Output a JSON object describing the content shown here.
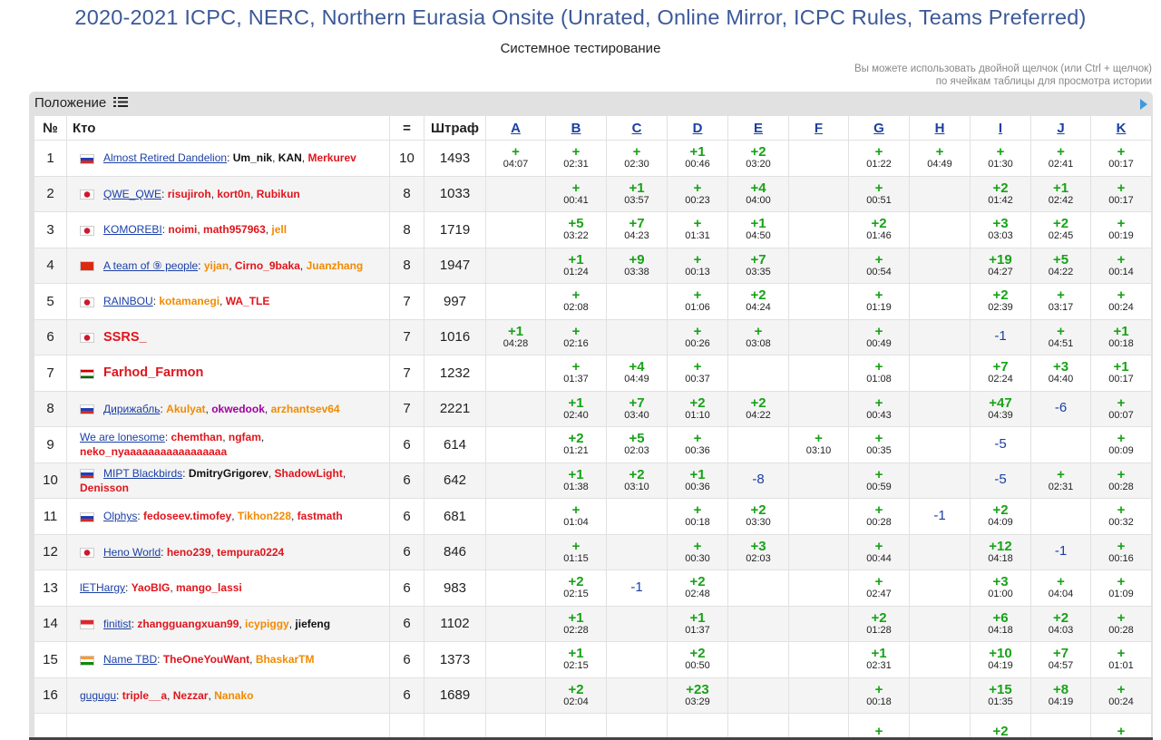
{
  "header": {
    "title": "2020-2021 ICPC, NERC, Northern Eurasia Onsite (Unrated, Online Mirror, ICPC Rules, Teams Preferred)",
    "subtitle": "Системное тестирование",
    "hint_line1": "Вы можете использовать двойной щелчок (или Ctrl + щелчок)",
    "hint_line2": "по ячейкам таблицы для просмотра истории"
  },
  "standings": {
    "panel_label": "Положение",
    "columns": {
      "rank": "№",
      "who": "Кто",
      "solved": "=",
      "penalty": "Штраф"
    },
    "problems": [
      "A",
      "B",
      "C",
      "D",
      "E",
      "F",
      "G",
      "H",
      "I",
      "J",
      "K"
    ],
    "rows": [
      {
        "rank": "1",
        "flag": "ru",
        "team": "Almost Retired Dandelion",
        "members": [
          {
            "n": "Um_nik",
            "c": "black"
          },
          {
            "n": "KAN",
            "c": "black"
          },
          {
            "n": "Merkurev",
            "c": "red"
          }
        ],
        "solved": "10",
        "penalty": "1493",
        "cells": [
          {
            "r": "+",
            "t": "04:07"
          },
          {
            "r": "+",
            "t": "02:31"
          },
          {
            "r": "+",
            "t": "02:30"
          },
          {
            "r": "+1",
            "t": "00:46"
          },
          {
            "r": "+2",
            "t": "03:20"
          },
          {},
          {
            "r": "+",
            "t": "01:22"
          },
          {
            "r": "+",
            "t": "04:49"
          },
          {
            "r": "+",
            "t": "01:30"
          },
          {
            "r": "+",
            "t": "02:41"
          },
          {
            "r": "+",
            "t": "00:17"
          }
        ]
      },
      {
        "rank": "2",
        "flag": "jp",
        "team": "QWE_QWE",
        "members": [
          {
            "n": "risujiroh",
            "c": "red"
          },
          {
            "n": "kort0n",
            "c": "red"
          },
          {
            "n": "Rubikun",
            "c": "red"
          }
        ],
        "solved": "8",
        "penalty": "1033",
        "cells": [
          {},
          {
            "r": "+",
            "t": "00:41"
          },
          {
            "r": "+1",
            "t": "03:57"
          },
          {
            "r": "+",
            "t": "00:23"
          },
          {
            "r": "+4",
            "t": "04:00"
          },
          {},
          {
            "r": "+",
            "t": "00:51"
          },
          {},
          {
            "r": "+2",
            "t": "01:42"
          },
          {
            "r": "+1",
            "t": "02:42"
          },
          {
            "r": "+",
            "t": "00:17"
          }
        ]
      },
      {
        "rank": "3",
        "flag": "jp",
        "team": "KOMOREBI",
        "members": [
          {
            "n": "noimi",
            "c": "red"
          },
          {
            "n": "math957963",
            "c": "red"
          },
          {
            "n": "jell",
            "c": "orange"
          }
        ],
        "solved": "8",
        "penalty": "1719",
        "cells": [
          {},
          {
            "r": "+5",
            "t": "03:22"
          },
          {
            "r": "+7",
            "t": "04:23"
          },
          {
            "r": "+",
            "t": "01:31"
          },
          {
            "r": "+1",
            "t": "04:50"
          },
          {},
          {
            "r": "+2",
            "t": "01:46"
          },
          {},
          {
            "r": "+3",
            "t": "03:03"
          },
          {
            "r": "+2",
            "t": "02:45"
          },
          {
            "r": "+",
            "t": "00:19"
          }
        ]
      },
      {
        "rank": "4",
        "flag": "cn",
        "team": "A team of ⑨ people",
        "members": [
          {
            "n": "yijan",
            "c": "orange"
          },
          {
            "n": "Cirno_9baka",
            "c": "red"
          },
          {
            "n": "Juanzhang",
            "c": "orange"
          }
        ],
        "solved": "8",
        "penalty": "1947",
        "cells": [
          {},
          {
            "r": "+1",
            "t": "01:24"
          },
          {
            "r": "+9",
            "t": "03:38"
          },
          {
            "r": "+",
            "t": "00:13"
          },
          {
            "r": "+7",
            "t": "03:35"
          },
          {},
          {
            "r": "+",
            "t": "00:54"
          },
          {},
          {
            "r": "+19",
            "t": "04:27"
          },
          {
            "r": "+5",
            "t": "04:22"
          },
          {
            "r": "+",
            "t": "00:14"
          }
        ]
      },
      {
        "rank": "5",
        "flag": "jp",
        "team": "RAINBOU",
        "members": [
          {
            "n": "kotamanegi",
            "c": "orange"
          },
          {
            "n": "WA_TLE",
            "c": "red"
          }
        ],
        "solved": "7",
        "penalty": "997",
        "cells": [
          {},
          {
            "r": "+",
            "t": "02:08"
          },
          {},
          {
            "r": "+",
            "t": "01:06"
          },
          {
            "r": "+2",
            "t": "04:24"
          },
          {},
          {
            "r": "+",
            "t": "01:19"
          },
          {},
          {
            "r": "+2",
            "t": "02:39"
          },
          {
            "r": "+",
            "t": "03:17"
          },
          {
            "r": "+",
            "t": "00:24"
          }
        ]
      },
      {
        "rank": "6",
        "flag": "jp",
        "team": "SSRS_",
        "single": true,
        "members": [],
        "solved": "7",
        "penalty": "1016",
        "cells": [
          {
            "r": "+1",
            "t": "04:28"
          },
          {
            "r": "+",
            "t": "02:16"
          },
          {},
          {
            "r": "+",
            "t": "00:26"
          },
          {
            "r": "+",
            "t": "03:08"
          },
          {},
          {
            "r": "+",
            "t": "00:49"
          },
          {},
          {
            "w": "-1"
          },
          {
            "r": "+",
            "t": "04:51"
          },
          {
            "r": "+1",
            "t": "00:18"
          }
        ]
      },
      {
        "rank": "7",
        "flag": "tj",
        "team": "Farhod_Farmon",
        "single": true,
        "members": [],
        "solved": "7",
        "penalty": "1232",
        "cells": [
          {},
          {
            "r": "+",
            "t": "01:37"
          },
          {
            "r": "+4",
            "t": "04:49"
          },
          {
            "r": "+",
            "t": "00:37"
          },
          {},
          {},
          {
            "r": "+",
            "t": "01:08"
          },
          {},
          {
            "r": "+7",
            "t": "02:24"
          },
          {
            "r": "+3",
            "t": "04:40"
          },
          {
            "r": "+1",
            "t": "00:17"
          }
        ]
      },
      {
        "rank": "8",
        "flag": "ru",
        "team": "Дирижабль",
        "members": [
          {
            "n": "Akulyat",
            "c": "orange"
          },
          {
            "n": "okwedook",
            "c": "purple"
          },
          {
            "n": "arzhantsev64",
            "c": "orange"
          }
        ],
        "solved": "7",
        "penalty": "2221",
        "cells": [
          {},
          {
            "r": "+1",
            "t": "02:40"
          },
          {
            "r": "+7",
            "t": "03:40"
          },
          {
            "r": "+2",
            "t": "01:10"
          },
          {
            "r": "+2",
            "t": "04:22"
          },
          {},
          {
            "r": "+",
            "t": "00:43"
          },
          {},
          {
            "r": "+47",
            "t": "04:39"
          },
          {
            "w": "-6"
          },
          {
            "r": "+",
            "t": "00:07"
          }
        ]
      },
      {
        "rank": "9",
        "flag": "",
        "team": "We are lonesome",
        "members": [
          {
            "n": "chemthan",
            "c": "red"
          },
          {
            "n": "ngfam",
            "c": "red"
          },
          {
            "n": "neko_nyaaaaaaaaaaaaaaaaa",
            "c": "red"
          }
        ],
        "solved": "6",
        "penalty": "614",
        "cells": [
          {},
          {
            "r": "+2",
            "t": "01:21"
          },
          {
            "r": "+5",
            "t": "02:03"
          },
          {
            "r": "+",
            "t": "00:36"
          },
          {},
          {
            "r": "+",
            "t": "03:10"
          },
          {
            "r": "+",
            "t": "00:35"
          },
          {},
          {
            "w": "-5"
          },
          {},
          {
            "r": "+",
            "t": "00:09"
          }
        ]
      },
      {
        "rank": "10",
        "flag": "ru",
        "team": "MIPT Blackbirds",
        "members": [
          {
            "n": "DmitryGrigorev",
            "c": "black"
          },
          {
            "n": "ShadowLight",
            "c": "red"
          },
          {
            "n": "Denisson",
            "c": "red"
          }
        ],
        "solved": "6",
        "penalty": "642",
        "cells": [
          {},
          {
            "r": "+1",
            "t": "01:38"
          },
          {
            "r": "+2",
            "t": "03:10"
          },
          {
            "r": "+1",
            "t": "00:36"
          },
          {
            "w": "-8"
          },
          {},
          {
            "r": "+",
            "t": "00:59"
          },
          {},
          {
            "w": "-5"
          },
          {
            "r": "+",
            "t": "02:31"
          },
          {
            "r": "+",
            "t": "00:28"
          }
        ]
      },
      {
        "rank": "11",
        "flag": "ru",
        "team": "Olphys",
        "members": [
          {
            "n": "fedoseev.timofey",
            "c": "red"
          },
          {
            "n": "Tikhon228",
            "c": "orange"
          },
          {
            "n": "fastmath",
            "c": "red"
          }
        ],
        "solved": "6",
        "penalty": "681",
        "cells": [
          {},
          {
            "r": "+",
            "t": "01:04"
          },
          {},
          {
            "r": "+",
            "t": "00:18"
          },
          {
            "r": "+2",
            "t": "03:30"
          },
          {},
          {
            "r": "+",
            "t": "00:28"
          },
          {
            "w": "-1"
          },
          {
            "r": "+2",
            "t": "04:09"
          },
          {},
          {
            "r": "+",
            "t": "00:32"
          }
        ]
      },
      {
        "rank": "12",
        "flag": "jp",
        "team": "Heno World",
        "members": [
          {
            "n": "heno239",
            "c": "red"
          },
          {
            "n": "tempura0224",
            "c": "red"
          }
        ],
        "solved": "6",
        "penalty": "846",
        "cells": [
          {},
          {
            "r": "+",
            "t": "01:15"
          },
          {},
          {
            "r": "+",
            "t": "00:30"
          },
          {
            "r": "+3",
            "t": "02:03"
          },
          {},
          {
            "r": "+",
            "t": "00:44"
          },
          {},
          {
            "r": "+12",
            "t": "04:18"
          },
          {
            "w": "-1"
          },
          {
            "r": "+",
            "t": "00:16"
          }
        ]
      },
      {
        "rank": "13",
        "flag": "",
        "team": "lETHargy",
        "members": [
          {
            "n": "YaoBIG",
            "c": "red"
          },
          {
            "n": "mango_lassi",
            "c": "red"
          }
        ],
        "solved": "6",
        "penalty": "983",
        "cells": [
          {},
          {
            "r": "+2",
            "t": "02:15"
          },
          {
            "w": "-1"
          },
          {
            "r": "+2",
            "t": "02:48"
          },
          {},
          {},
          {
            "r": "+",
            "t": "02:47"
          },
          {},
          {
            "r": "+3",
            "t": "01:00"
          },
          {
            "r": "+",
            "t": "04:04"
          },
          {
            "r": "+",
            "t": "01:09"
          }
        ]
      },
      {
        "rank": "14",
        "flag": "sg",
        "team": "finitist",
        "members": [
          {
            "n": "zhangguangxuan99",
            "c": "red"
          },
          {
            "n": "icypiggy",
            "c": "orange"
          },
          {
            "n": "jiefeng",
            "c": "black"
          }
        ],
        "solved": "6",
        "penalty": "1102",
        "cells": [
          {},
          {
            "r": "+1",
            "t": "02:28"
          },
          {},
          {
            "r": "+1",
            "t": "01:37"
          },
          {},
          {},
          {
            "r": "+2",
            "t": "01:28"
          },
          {},
          {
            "r": "+6",
            "t": "04:18"
          },
          {
            "r": "+2",
            "t": "04:03"
          },
          {
            "r": "+",
            "t": "00:28"
          }
        ]
      },
      {
        "rank": "15",
        "flag": "in",
        "team": "Name TBD",
        "members": [
          {
            "n": "TheOneYouWant",
            "c": "red"
          },
          {
            "n": "BhaskarTM",
            "c": "orange"
          }
        ],
        "solved": "6",
        "penalty": "1373",
        "cells": [
          {},
          {
            "r": "+1",
            "t": "02:15"
          },
          {},
          {
            "r": "+2",
            "t": "00:50"
          },
          {},
          {},
          {
            "r": "+1",
            "t": "02:31"
          },
          {},
          {
            "r": "+10",
            "t": "04:19"
          },
          {
            "r": "+7",
            "t": "04:57"
          },
          {
            "r": "+",
            "t": "01:01"
          }
        ]
      },
      {
        "rank": "16",
        "flag": "",
        "team": "gugugu",
        "members": [
          {
            "n": "triple__a",
            "c": "red"
          },
          {
            "n": "Nezzar",
            "c": "red"
          },
          {
            "n": "Nanako",
            "c": "orange"
          }
        ],
        "solved": "6",
        "penalty": "1689",
        "cells": [
          {},
          {
            "r": "+2",
            "t": "02:04"
          },
          {},
          {
            "r": "+23",
            "t": "03:29"
          },
          {},
          {},
          {
            "r": "+",
            "t": "00:18"
          },
          {},
          {
            "r": "+15",
            "t": "01:35"
          },
          {
            "r": "+8",
            "t": "04:19"
          },
          {
            "r": "+",
            "t": "00:24"
          }
        ]
      },
      {
        "rank": "",
        "flag": "",
        "team": "",
        "members": [],
        "solved": "",
        "penalty": "",
        "cells": [
          {},
          {},
          {},
          {},
          {},
          {},
          {
            "r": "+"
          },
          {},
          {
            "r": "+2"
          },
          {},
          {
            "r": "+"
          }
        ]
      }
    ]
  }
}
